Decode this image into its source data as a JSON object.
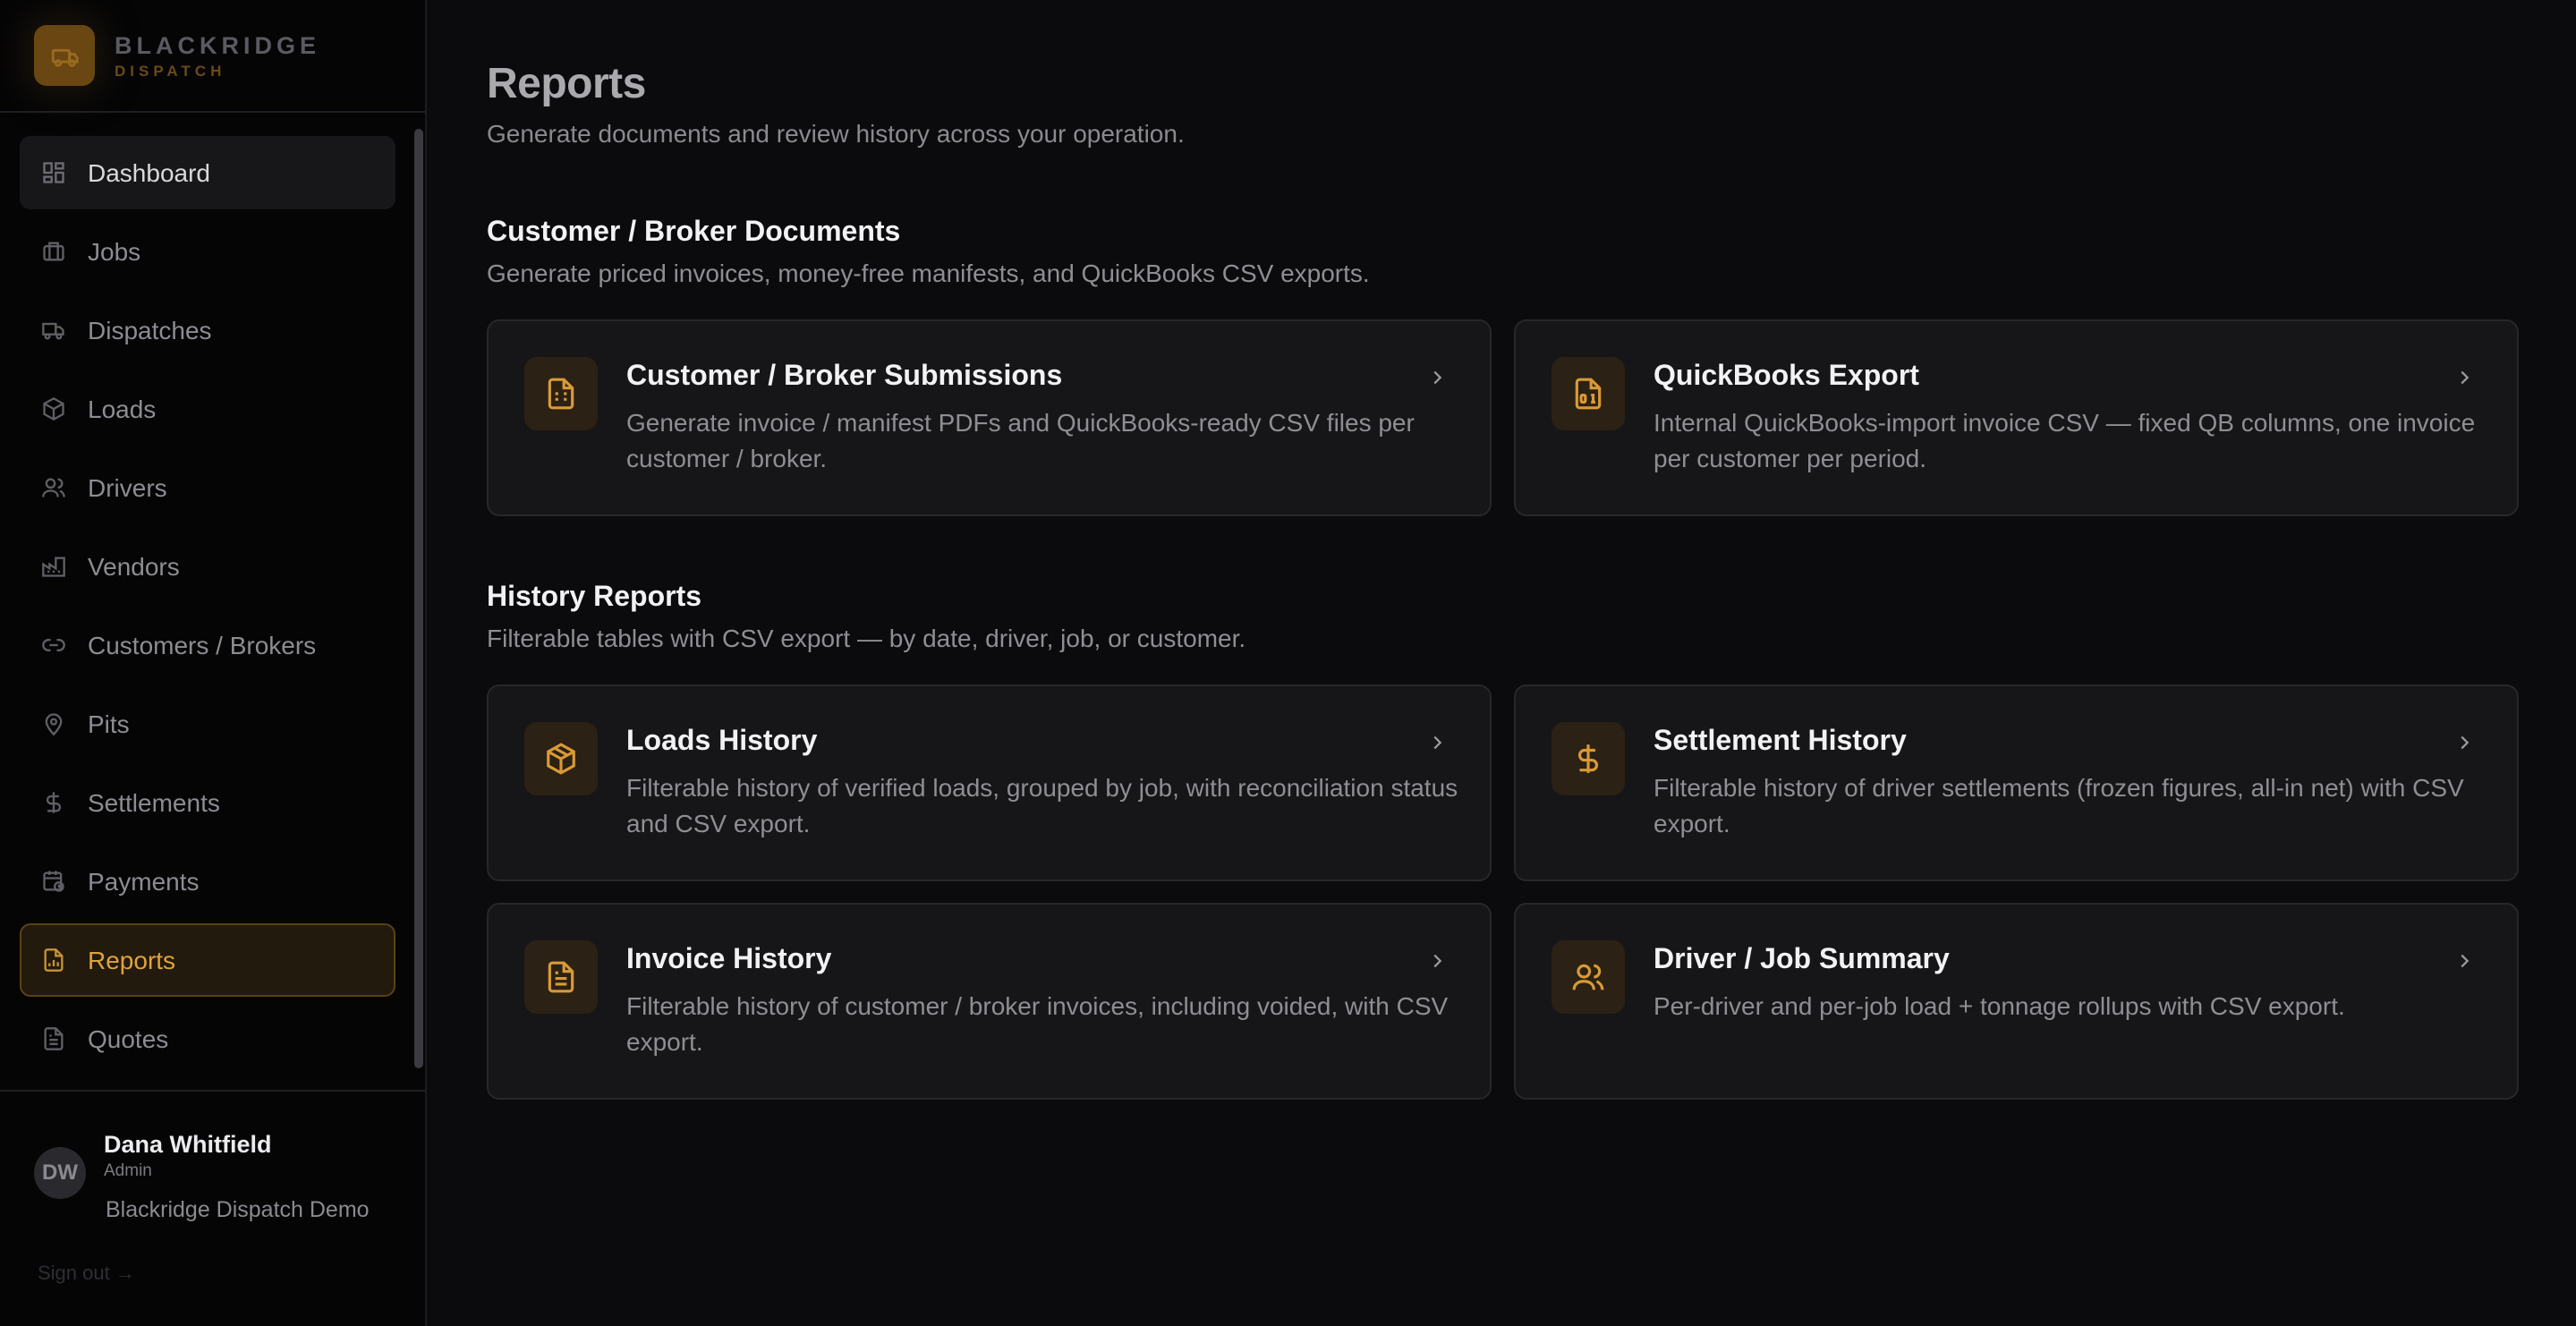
{
  "brand": {
    "name": "BLACKRIDGE",
    "sub": "DISPATCH"
  },
  "nav": [
    {
      "label": "Dashboard",
      "icon": "dashboard-grid-icon"
    },
    {
      "label": "Jobs",
      "icon": "briefcase-icon"
    },
    {
      "label": "Dispatches",
      "icon": "truck-icon"
    },
    {
      "label": "Loads",
      "icon": "package-icon"
    },
    {
      "label": "Drivers",
      "icon": "users-icon"
    },
    {
      "label": "Vendors",
      "icon": "factory-icon"
    },
    {
      "label": "Customers / Brokers",
      "icon": "link-icon"
    },
    {
      "label": "Pits",
      "icon": "map-pin-icon"
    },
    {
      "label": "Settlements",
      "icon": "dollar-icon"
    },
    {
      "label": "Payments",
      "icon": "calendar-clock-icon"
    },
    {
      "label": "Reports",
      "icon": "file-chart-icon"
    },
    {
      "label": "Quotes",
      "icon": "file-text-icon"
    }
  ],
  "active_nav": "Reports",
  "user": {
    "initials": "DW",
    "name": "Dana Whitfield",
    "role": "Admin",
    "org": "Blackridge Dispatch Demo",
    "signout": "Sign out →"
  },
  "page": {
    "title": "Reports",
    "subtitle": "Generate documents and review history across your operation."
  },
  "sections": [
    {
      "title": "Customer / Broker Documents",
      "subtitle": "Generate priced invoices, money-free manifests, and QuickBooks CSV exports.",
      "cards": [
        {
          "title": "Customer / Broker Submissions",
          "desc": "Generate invoice / manifest PDFs and QuickBooks-ready CSV files per customer / broker.",
          "icon": "file-spreadsheet-icon"
        },
        {
          "title": "QuickBooks Export",
          "desc": "Internal QuickBooks-import invoice CSV — fixed QB columns, one invoice per customer per period.",
          "icon": "file-digit-icon"
        }
      ]
    },
    {
      "title": "History Reports",
      "subtitle": "Filterable tables with CSV export — by date, driver, job, or customer.",
      "cards": [
        {
          "title": "Loads History",
          "desc": "Filterable history of verified loads, grouped by job, with reconciliation status and CSV export.",
          "icon": "package-icon"
        },
        {
          "title": "Settlement History",
          "desc": "Filterable history of driver settlements (frozen figures, all-in net) with CSV export.",
          "icon": "dollar-icon"
        },
        {
          "title": "Invoice History",
          "desc": "Filterable history of customer / broker invoices, including voided, with CSV export.",
          "icon": "file-text-icon"
        },
        {
          "title": "Driver / Job Summary",
          "desc": "Per-driver and per-job load + tonnage rollups with CSV export.",
          "icon": "users-icon"
        }
      ]
    }
  ],
  "colors": {
    "accent": "#e0a33a",
    "background": "#0b0b0d",
    "card": "#161618"
  }
}
